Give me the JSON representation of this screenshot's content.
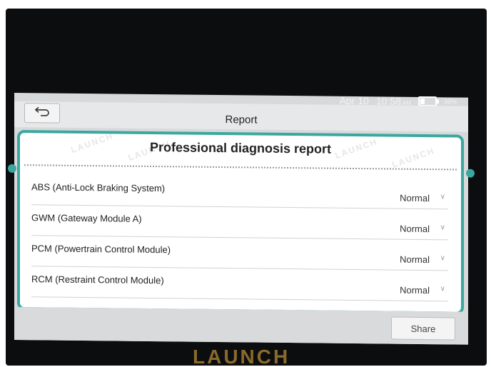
{
  "status": {
    "date": "Apr 10",
    "time": "10:58",
    "ampm": "AM",
    "battery_percent": "36%",
    "battery_level": 0.36
  },
  "titlebar": {
    "back_icon": "back-arrow-icon",
    "title": "Report"
  },
  "report": {
    "heading": "Professional diagnosis report",
    "watermark": "LAUNCH",
    "items": [
      {
        "name": "ABS (Anti-Lock Braking System)",
        "status": "Normal"
      },
      {
        "name": "GWM (Gateway Module A)",
        "status": "Normal"
      },
      {
        "name": "PCM (Powertrain Control Module)",
        "status": "Normal"
      },
      {
        "name": "RCM (Restraint Control Module)",
        "status": "Normal"
      }
    ]
  },
  "bottombar": {
    "share_label": "Share"
  },
  "device": {
    "brand": "LAUNCH"
  },
  "colors": {
    "accent": "#3aa8a0",
    "device_frame": "#0c0d0f"
  }
}
